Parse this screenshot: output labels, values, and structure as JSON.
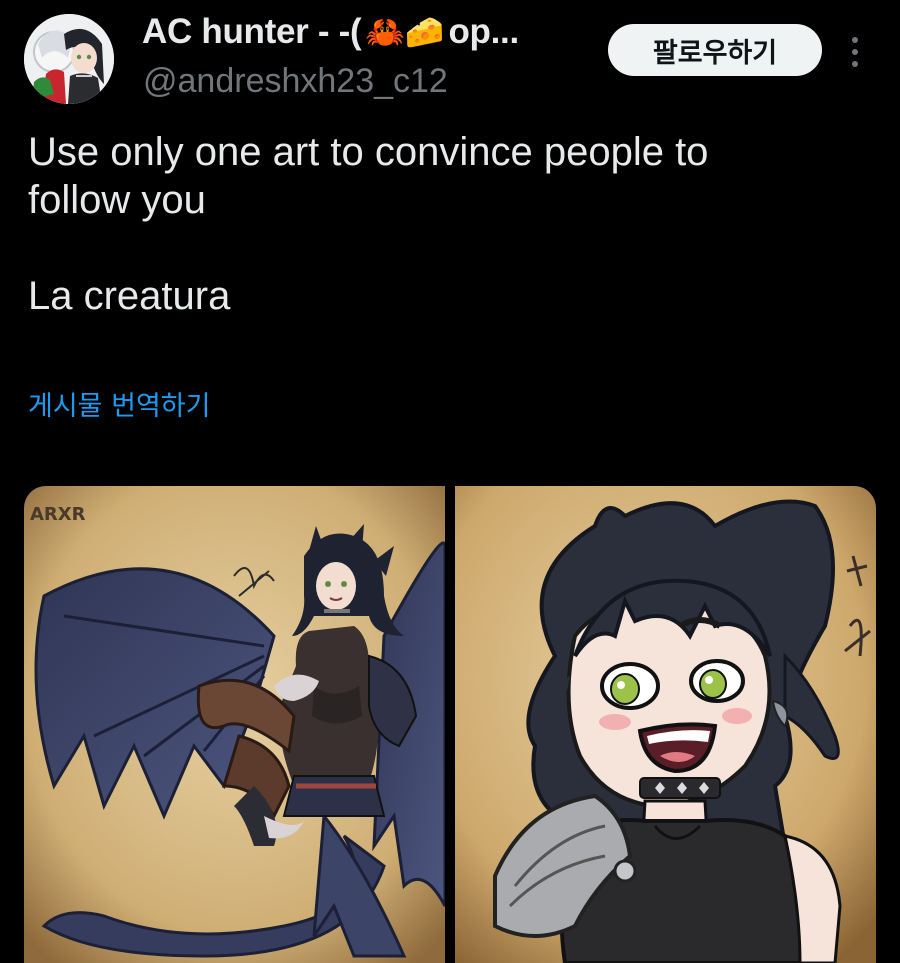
{
  "author": {
    "display_name": "AC hunter - -(",
    "name_emojis": "🦀🧀",
    "name_tail": "op...",
    "handle": "@andreshxh23_c12"
  },
  "actions": {
    "follow_label": "팔로우하기",
    "more_icon": "more-vertical-icon"
  },
  "tweet": {
    "text": "Use only one art to convince people to\nfollow you\n\nLa creatura",
    "translate_label": "게시물 번역하기"
  },
  "media": {
    "left_signature": "ARXR"
  },
  "colors": {
    "background": "#000000",
    "text": "#e7e9ea",
    "secondary": "#71767b",
    "link": "#1d9bf0",
    "button_bg": "#eff3f4"
  }
}
